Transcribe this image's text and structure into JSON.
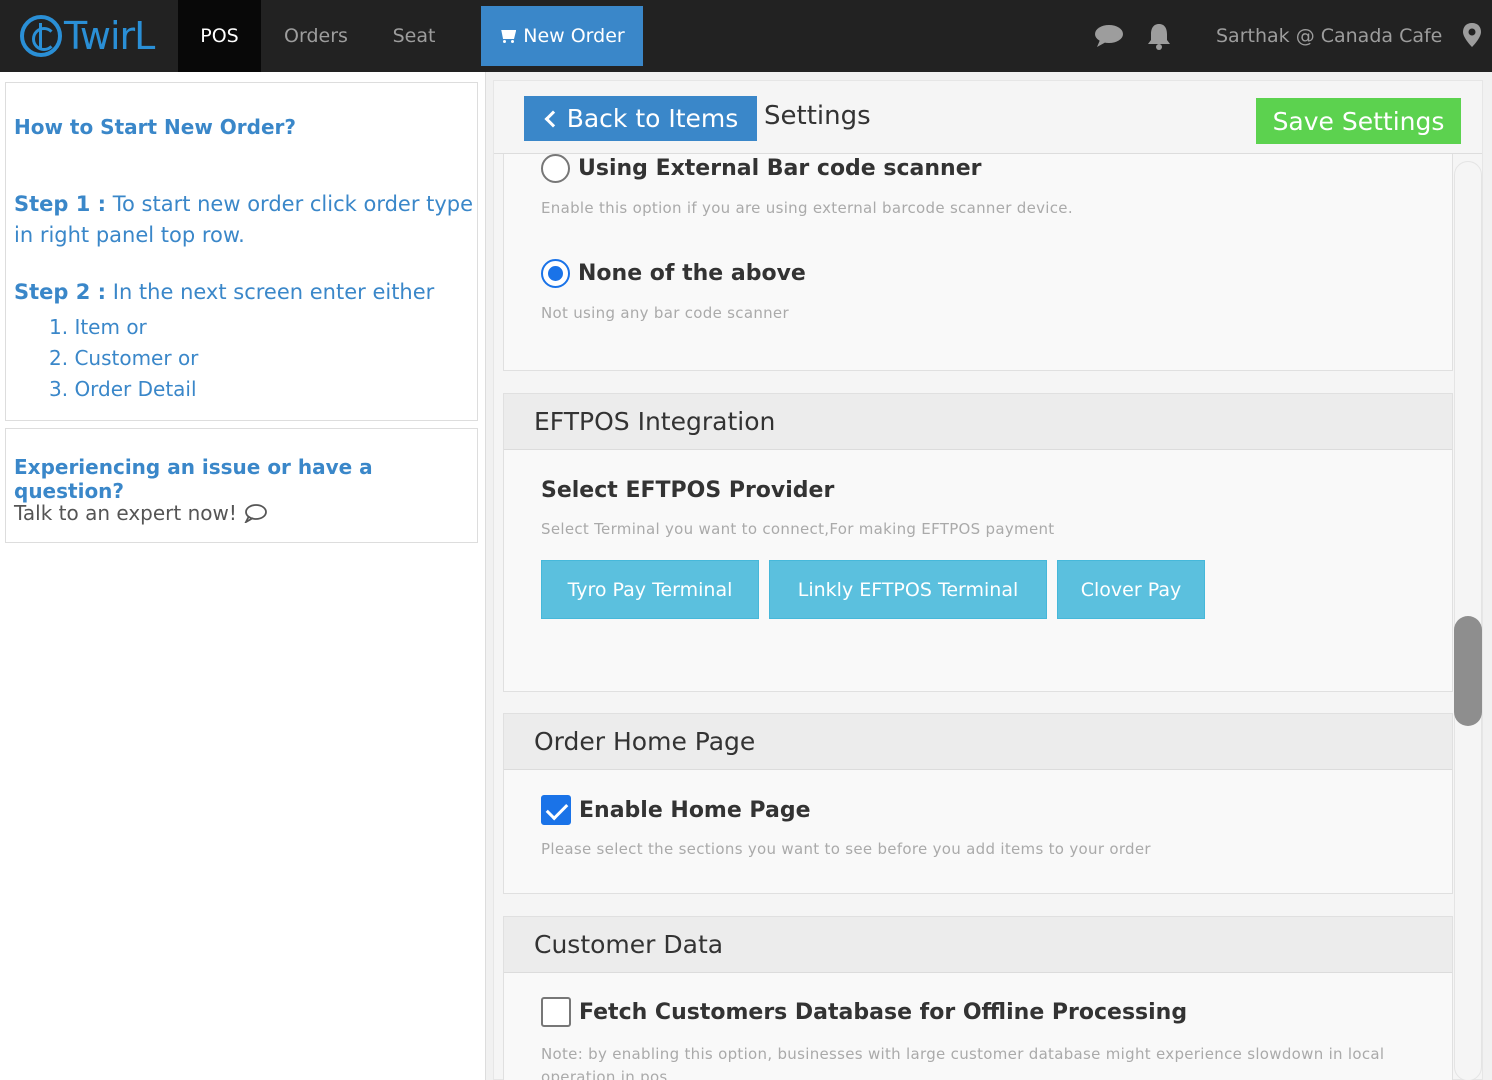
{
  "topbar": {
    "logo": "TwirL",
    "nav": {
      "pos": "POS",
      "orders": "Orders",
      "seat": "Seat"
    },
    "new_order": "New Order",
    "user": "Sarthak @ Canada Cafe",
    "icons": [
      "chat-icon",
      "bell-icon",
      "map-pin-icon",
      "cart-icon"
    ]
  },
  "help": {
    "title": "How to Start New Order?",
    "step1_label": "Step 1 :",
    "step1_text": " To start new order click order type in right panel top row.",
    "step2_label": "Step 2 :",
    "step2_text": " In the next screen enter either",
    "items": [
      "1. Item or",
      "2. Customer or",
      "3. Order Detail"
    ]
  },
  "issue": {
    "title": "Experiencing an issue or have a question?",
    "expert": "Talk to an expert now!"
  },
  "settings": {
    "back": "Back to Items",
    "title": "Settings",
    "save": "Save Settings",
    "scanner": {
      "external_label": "Using External Bar code scanner",
      "external_hint": "Enable this option if you are using external barcode scanner device.",
      "external_selected": false,
      "none_label": "None of the above",
      "none_hint": "Not using any bar code scanner",
      "none_selected": true
    },
    "eftpos": {
      "header": "EFTPOS Integration",
      "sub": "Select EFTPOS Provider",
      "hint": "Select Terminal you want to connect,For making EFTPOS payment",
      "providers": [
        "Tyro Pay Terminal",
        "Linkly EFTPOS Terminal",
        "Clover Pay"
      ]
    },
    "home": {
      "header": "Order Home Page",
      "label": "Enable Home Page",
      "checked": true,
      "hint": "Please select the sections you want to see before you add items to your order"
    },
    "customer": {
      "header": "Customer Data",
      "label": "Fetch Customers Database for Offline Processing",
      "checked": false,
      "hint": "Note: by enabling this option, businesses with large customer database might experience slowdown in local operation in pos"
    }
  },
  "colors": {
    "accent": "#3a87c9",
    "save": "#5cd24f",
    "provider": "#5bc0de",
    "topbar": "#222222"
  }
}
